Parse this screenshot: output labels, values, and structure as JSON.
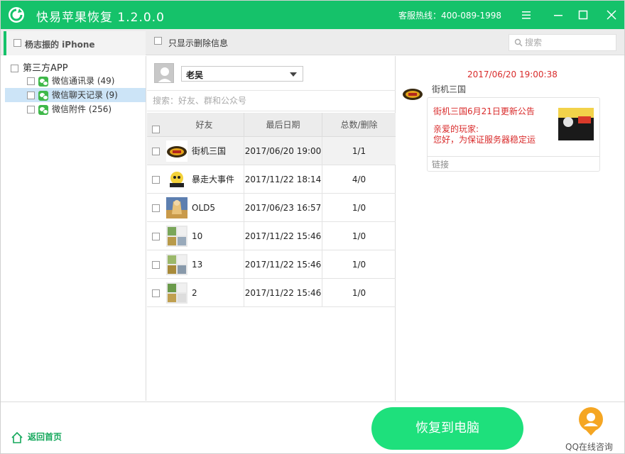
{
  "app": {
    "title": "快易苹果恢复  1.2.0.0",
    "hotline": "客服热线：400-089-1998",
    "accent_color": "#15c26a"
  },
  "window_controls": [
    "menu-icon",
    "minimize-icon",
    "maximize-icon",
    "close-icon"
  ],
  "toolbar": {
    "device_name": "杨志振的 iPhone",
    "only_deleted_label": "只显示删除信息",
    "search_placeholder": "搜索"
  },
  "tree": {
    "root": "第三方APP",
    "items": [
      {
        "label": "微信通讯录 (49)",
        "selected": false
      },
      {
        "label": "微信聊天记录 (9)",
        "selected": true
      },
      {
        "label": "微信附件 (256)",
        "selected": false
      }
    ]
  },
  "account": {
    "selected": "老吴",
    "friend_search_placeholder": "搜索：好友、群和公众号"
  },
  "table": {
    "headers": {
      "friend": "好友",
      "date": "最后日期",
      "total": "总数/删除"
    },
    "rows": [
      {
        "name": "街机三国",
        "date": "2017/06/20 19:00",
        "total": "1/1",
        "selected": true
      },
      {
        "name": "暴走大事件",
        "date": "2017/11/22 18:14",
        "total": "4/0",
        "selected": false
      },
      {
        "name": "OLD5",
        "date": "2017/06/23 16:57",
        "total": "1/0",
        "selected": false
      },
      {
        "name": "10",
        "date": "2017/11/22 15:46",
        "total": "1/0",
        "selected": false
      },
      {
        "name": "13",
        "date": "2017/11/22 15:46",
        "total": "1/0",
        "selected": false
      },
      {
        "name": "2",
        "date": "2017/11/22 15:46",
        "total": "1/0",
        "selected": false
      }
    ]
  },
  "message": {
    "time": "2017/06/20 19:00:38",
    "sender": "街机三国",
    "card_title": "街机三国6月21日更新公告",
    "card_body": "亲爱的玩家:\n您好，为保证服务器稳定运",
    "card_footer": "链接"
  },
  "bottom": {
    "home_label": "返回首页",
    "restore_button": "恢复到电脑",
    "qq_label": "QQ在线咨询"
  }
}
